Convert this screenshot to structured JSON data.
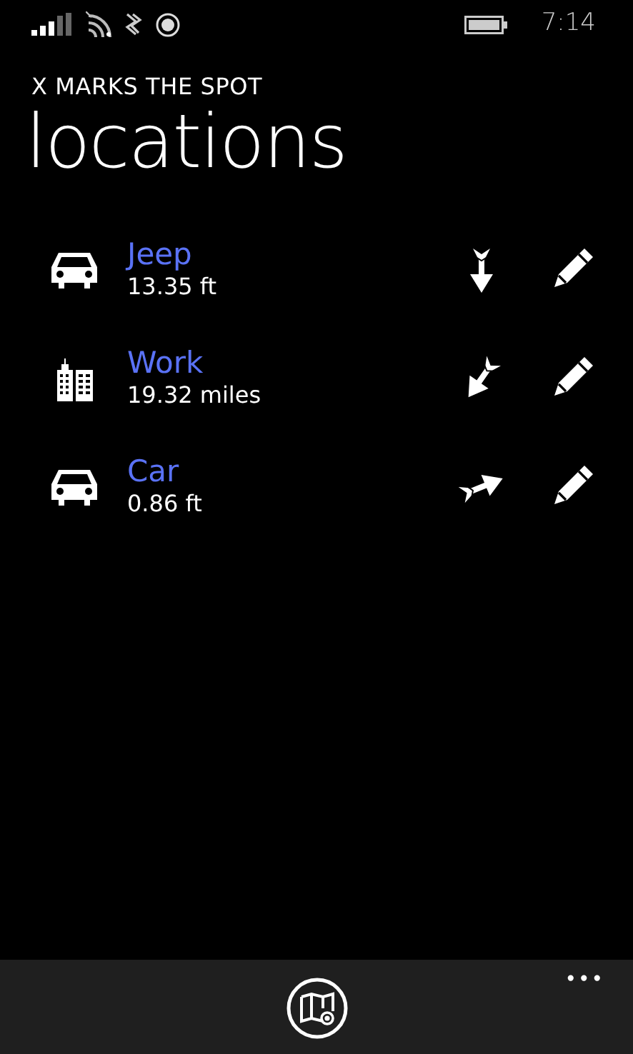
{
  "status_bar": {
    "time": "7:14"
  },
  "app_title": "X MARKS THE SPOT",
  "page_title": "locations",
  "locations": [
    {
      "name": "Jeep",
      "distance": "13.35 ft",
      "kind": "car",
      "arrow": {
        "kind": "down"
      }
    },
    {
      "name": "Work",
      "distance": "19.32 miles",
      "kind": "building",
      "arrow": {
        "kind": "downleft"
      }
    },
    {
      "name": "Car",
      "distance": "0.86 ft",
      "kind": "car",
      "arrow": {
        "kind": "upright"
      }
    }
  ],
  "app_bar": {
    "buttons": [
      {
        "kind": "map"
      }
    ],
    "more": "•••"
  }
}
